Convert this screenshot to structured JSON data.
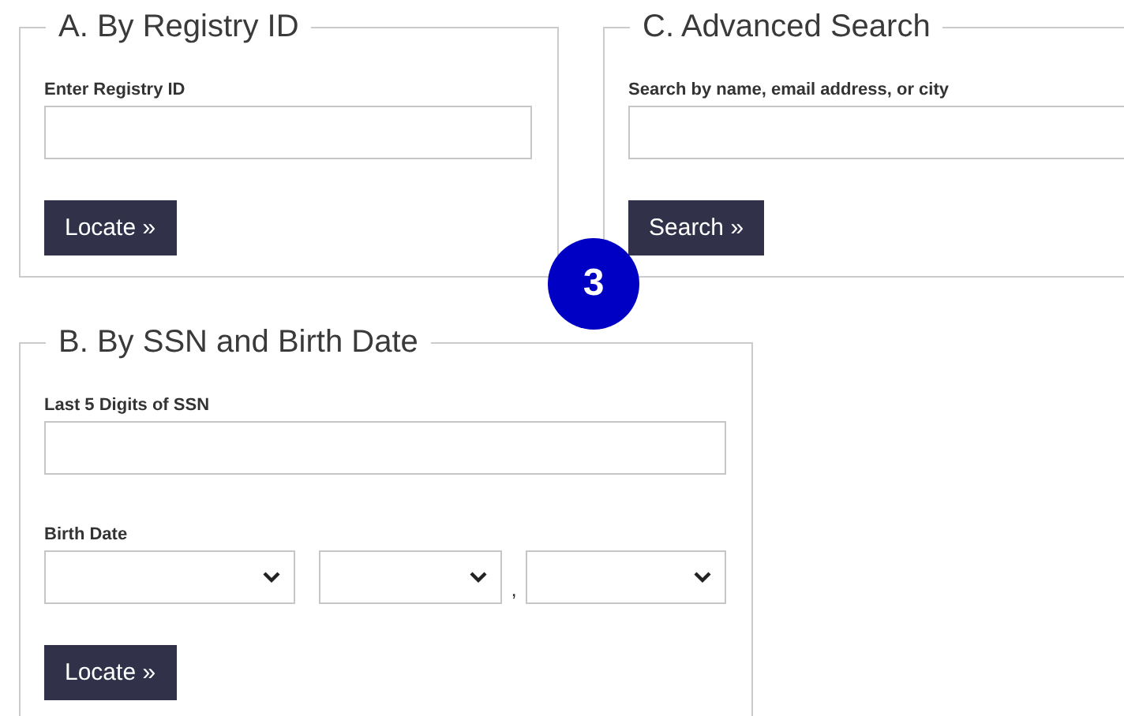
{
  "rows": [
    [
      {
        "legend": "A. By Registry ID",
        "fields": [
          {
            "kind": "text",
            "label": "Enter Registry ID"
          }
        ],
        "button": "Locate »"
      },
      {
        "legend": "C. Advanced Search",
        "fields": [
          {
            "kind": "text",
            "label": "Search by name, email address, or city"
          }
        ],
        "button": "Search »"
      }
    ],
    [
      {
        "legend": "B. By SSN and Birth Date",
        "fields": [
          {
            "kind": "text",
            "label": "Last 5 Digits of SSN"
          },
          {
            "kind": "date",
            "label": "Birth Date",
            "separator": ","
          }
        ],
        "button": "Locate »"
      }
    ]
  ],
  "badge": {
    "number": "3"
  }
}
